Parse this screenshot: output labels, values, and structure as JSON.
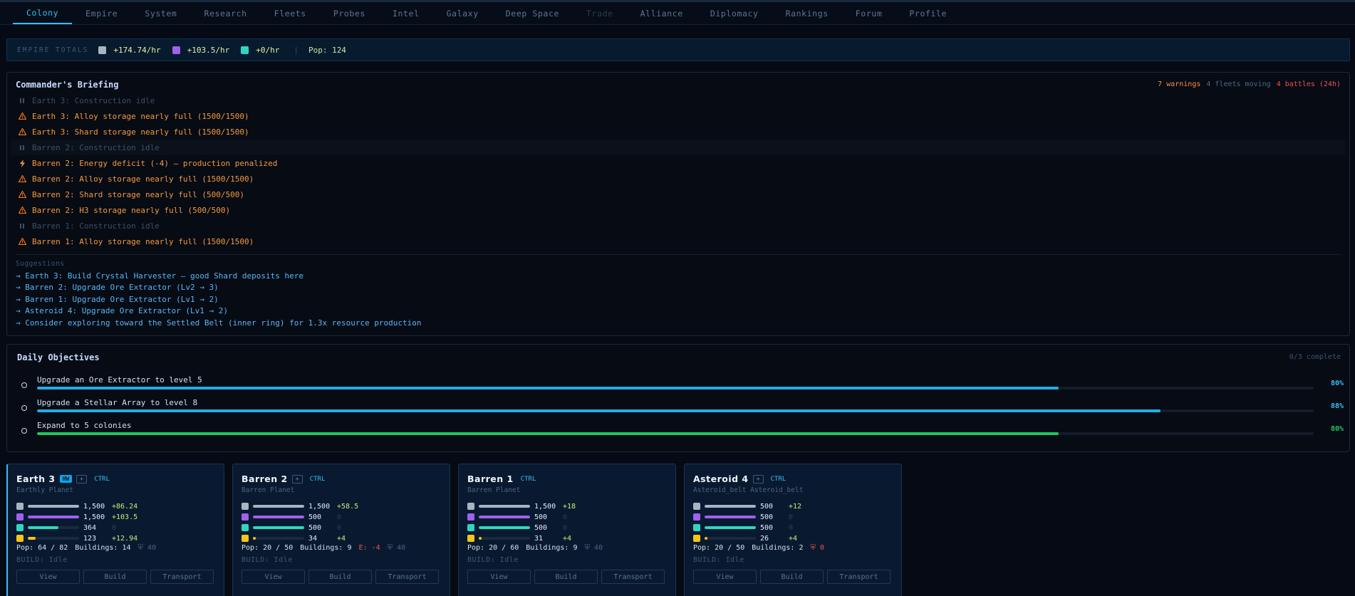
{
  "nav": {
    "tabs": [
      {
        "label": "Colony",
        "state": "active"
      },
      {
        "label": "Empire",
        "state": ""
      },
      {
        "label": "System",
        "state": ""
      },
      {
        "label": "Research",
        "state": ""
      },
      {
        "label": "Fleets",
        "state": ""
      },
      {
        "label": "Probes",
        "state": ""
      },
      {
        "label": "Intel",
        "state": ""
      },
      {
        "label": "Galaxy",
        "state": ""
      },
      {
        "label": "Deep Space",
        "state": ""
      },
      {
        "label": "Trade",
        "state": "disabled"
      },
      {
        "label": "Alliance",
        "state": ""
      },
      {
        "label": "Diplomacy",
        "state": ""
      },
      {
        "label": "Rankings",
        "state": ""
      },
      {
        "label": "Forum",
        "state": ""
      },
      {
        "label": "Profile",
        "state": ""
      }
    ]
  },
  "colors": {
    "ore": "#a9b4c2",
    "shard": "#a060f0",
    "h3": "#2ed6c0",
    "energy": "#f5c518",
    "accent": "#38bdf8",
    "progress_blue": "#1eaee8",
    "progress_green": "#22c55e"
  },
  "totals": {
    "label": "EMPIRE TOTALS",
    "ore_rate": "+174.74/hr",
    "shard_rate": "+103.5/hr",
    "h3_rate": "+0/hr",
    "pop": "Pop: 124"
  },
  "briefing": {
    "title": "Commander's Briefing",
    "warnings": "7 warnings",
    "fleets": "4 fleets moving",
    "battles": "4 battles (24h)",
    "alerts": [
      {
        "icon": "pause-icon",
        "type": "idle",
        "text": "Earth 3: Construction idle"
      },
      {
        "icon": "warning-icon",
        "type": "warn",
        "text": "Earth 3: Alloy storage nearly full (1500/1500)"
      },
      {
        "icon": "warning-icon",
        "type": "warn",
        "text": "Earth 3: Shard storage nearly full (1500/1500)"
      },
      {
        "icon": "pause-icon",
        "type": "idle hl",
        "text": "Barren 2: Construction idle"
      },
      {
        "icon": "bolt-icon",
        "type": "warn",
        "text": "Barren 2: Energy deficit (-4) — production penalized"
      },
      {
        "icon": "warning-icon",
        "type": "warn",
        "text": "Barren 2: Alloy storage nearly full (1500/1500)"
      },
      {
        "icon": "warning-icon",
        "type": "warn",
        "text": "Barren 2: Shard storage nearly full (500/500)"
      },
      {
        "icon": "warning-icon",
        "type": "warn",
        "text": "Barren 2: H3 storage nearly full (500/500)"
      },
      {
        "icon": "pause-icon",
        "type": "idle",
        "text": "Barren 1: Construction idle"
      },
      {
        "icon": "warning-icon",
        "type": "warn",
        "text": "Barren 1: Alloy storage nearly full (1500/1500)"
      }
    ],
    "suggestions_title": "Suggestions",
    "suggestions": [
      "→ Earth 3: Build Crystal Harvester — good Shard deposits here",
      "→ Barren 2: Upgrade Ore Extractor (Lv2 → 3)",
      "→ Barren 1: Upgrade Ore Extractor (Lv1 → 2)",
      "→ Asteroid 4: Upgrade Ore Extractor (Lv1 → 2)",
      "→ Consider exploring toward the Settled Belt (inner ring) for 1.3x resource production"
    ]
  },
  "objectives": {
    "title": "Daily Objectives",
    "count": "0/3 complete",
    "items": [
      {
        "text": "Upgrade an Ore Extractor to level 5",
        "progress": 0.8,
        "pct": "80%",
        "color": "#1eaee8",
        "pct_color": "#38bdf8"
      },
      {
        "text": "Upgrade a Stellar Array to level 8",
        "progress": 0.88,
        "pct": "88%",
        "color": "#1eaee8",
        "pct_color": "#38bdf8"
      },
      {
        "text": "Expand to 5 colonies",
        "progress": 0.8,
        "pct": "80%",
        "color": "#22c55e",
        "pct_color": "#22c55e"
      }
    ]
  },
  "colonies": [
    {
      "name": "Earth 3",
      "hw": "HW",
      "plus": "+",
      "ctrl": "CTRL",
      "sub": "Earthly Planet",
      "active": true,
      "resources": [
        {
          "amount": "1,500",
          "rate": "+86.24",
          "fill": 1.0
        },
        {
          "amount": "1,500",
          "rate": "+103.5",
          "fill": 1.0
        },
        {
          "amount": "364",
          "rate": "0",
          "fill": 0.6
        },
        {
          "amount": "123",
          "rate": "+12.94",
          "fill": 0.15
        }
      ],
      "pop": "Pop: 64 / 82",
      "buildings": "Buildings: 14",
      "energy": "",
      "defense": "⛨ 40",
      "defense_red": false,
      "build": "BUILD: Idle"
    },
    {
      "name": "Barren 2",
      "hw": "",
      "plus": "+",
      "ctrl": "CTRL",
      "sub": "Barren Planet",
      "active": false,
      "resources": [
        {
          "amount": "1,500",
          "rate": "+58.5",
          "fill": 1.0
        },
        {
          "amount": "500",
          "rate": "0",
          "fill": 1.0
        },
        {
          "amount": "500",
          "rate": "0",
          "fill": 1.0
        },
        {
          "amount": "34",
          "rate": "+4",
          "fill": 0.05
        }
      ],
      "pop": "Pop: 20 / 50",
      "buildings": "Buildings: 9",
      "energy": "E: -4",
      "defense": "⛨ 40",
      "defense_red": false,
      "build": "BUILD: Idle"
    },
    {
      "name": "Barren 1",
      "hw": "",
      "plus": "",
      "ctrl": "CTRL",
      "sub": "Barren Planet",
      "active": false,
      "resources": [
        {
          "amount": "1,500",
          "rate": "+18",
          "fill": 1.0
        },
        {
          "amount": "500",
          "rate": "0",
          "fill": 1.0
        },
        {
          "amount": "500",
          "rate": "0",
          "fill": 1.0
        },
        {
          "amount": "31",
          "rate": "+4",
          "fill": 0.05
        }
      ],
      "pop": "Pop: 20 / 60",
      "buildings": "Buildings: 9",
      "energy": "",
      "defense": "⛨ 40",
      "defense_red": false,
      "build": "BUILD: Idle"
    },
    {
      "name": "Asteroid 4",
      "hw": "",
      "plus": "+",
      "ctrl": "CTRL",
      "sub": "Asteroid_belt Asteroid_belt",
      "active": false,
      "resources": [
        {
          "amount": "500",
          "rate": "+12",
          "fill": 1.0
        },
        {
          "amount": "500",
          "rate": "0",
          "fill": 1.0
        },
        {
          "amount": "500",
          "rate": "0",
          "fill": 1.0
        },
        {
          "amount": "26",
          "rate": "+4",
          "fill": 0.05
        }
      ],
      "pop": "Pop: 20 / 50",
      "buildings": "Buildings: 2",
      "energy": "",
      "defense": "⛨ 0",
      "defense_red": true,
      "build": "BUILD: Idle"
    }
  ],
  "card_buttons": {
    "view": "View",
    "build": "Build",
    "transport": "Transport"
  }
}
